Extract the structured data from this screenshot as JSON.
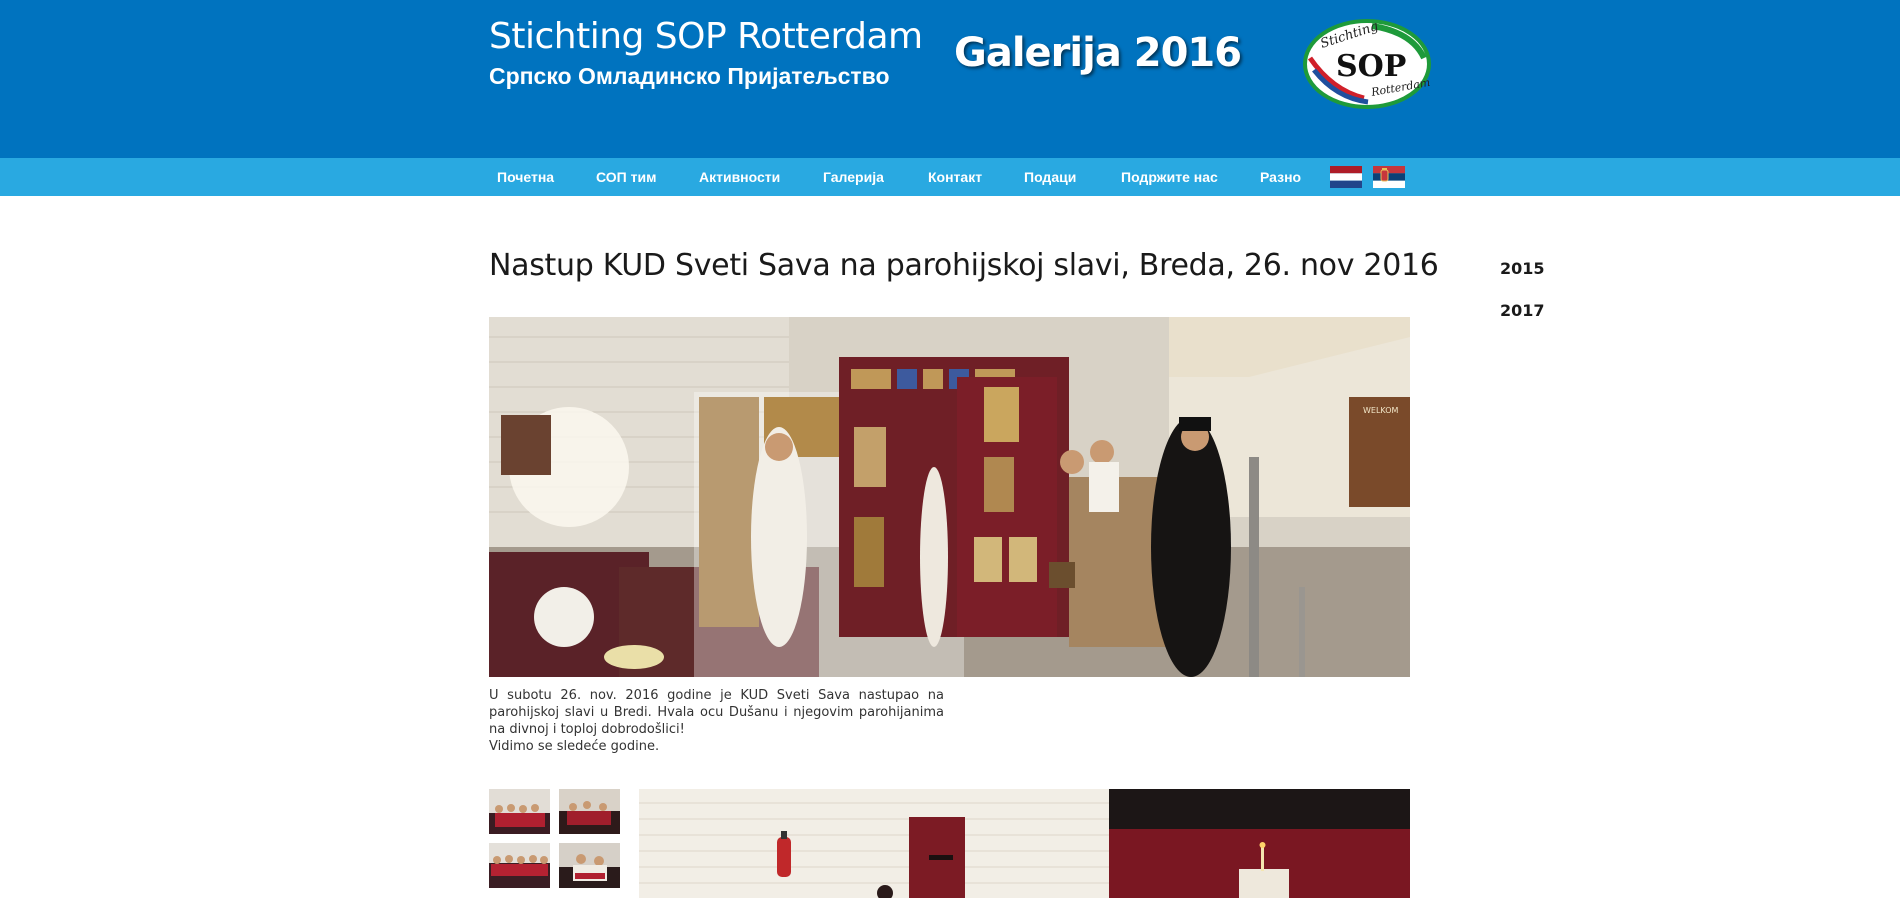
{
  "header": {
    "title": "Stichting SOP Rotterdam",
    "subtitle": "Српско Омладинско Пријатељство",
    "gallery_heading": "Galerija 2016",
    "logo": {
      "top_text": "Stichting",
      "main_text": "SOP",
      "bottom_text": "Rotterdam"
    }
  },
  "nav": {
    "items": [
      {
        "label": "Почетна"
      },
      {
        "label": "СОП тим"
      },
      {
        "label": "Активности"
      },
      {
        "label": "Галерија"
      },
      {
        "label": "Контакт"
      },
      {
        "label": "Подаци"
      },
      {
        "label": "Подржите нас"
      },
      {
        "label": "Разно"
      }
    ],
    "flags": [
      "netherlands-flag",
      "serbia-flag"
    ]
  },
  "post": {
    "title": "Nastup KUD Sveti Sava na parohijskoj slavi, Breda, 26. nov 2016",
    "caption_paragraph": "U subotu 26. nov. 2016 godine je KUD Sveti Sava nastupao na parohijskoj slavi u Bredi. Hvala ocu Dušanu i njegovim parohijanima na divnoj i toploj dobrodošlici!",
    "caption_line2": "Vidimo se sledeće godine.",
    "photo_sign_text": "WELKOM"
  },
  "sidebar": {
    "years": [
      {
        "label": "2015"
      },
      {
        "label": "2017"
      }
    ]
  },
  "colors": {
    "header_bg": "#0073bf",
    "nav_bg": "#29a9e1",
    "text_dark": "#1a1a1a",
    "logo_green": "#1e9a3a",
    "logo_red": "#d0202a",
    "logo_blue": "#1f4f9e"
  }
}
